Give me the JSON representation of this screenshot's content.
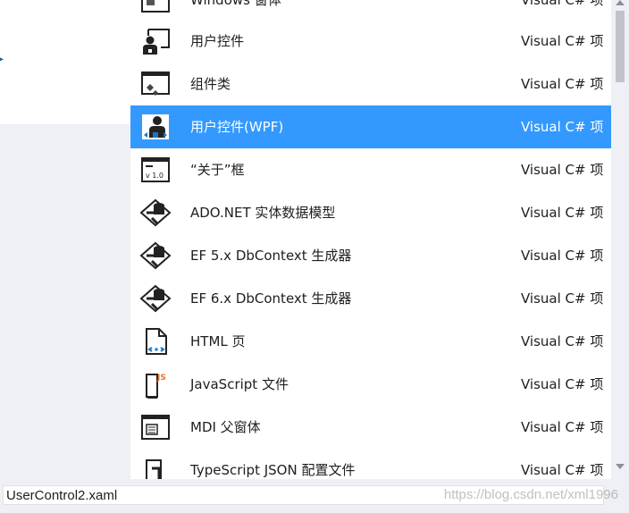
{
  "items": [
    {
      "name": "Windows 窗体",
      "lang": "Visual C# 项",
      "icon": "windows-form-icon",
      "selected": false
    },
    {
      "name": "用户控件",
      "lang": "Visual C# 项",
      "icon": "user-control-icon",
      "selected": false
    },
    {
      "name": "组件类",
      "lang": "Visual C# 项",
      "icon": "component-class-icon",
      "selected": false
    },
    {
      "name": "用户控件(WPF)",
      "lang": "Visual C# 项",
      "icon": "user-control-wpf-icon",
      "selected": true
    },
    {
      "name": "“关于”框",
      "lang": "Visual C# 项",
      "icon": "about-box-icon",
      "selected": false
    },
    {
      "name": "ADO.NET 实体数据模型",
      "lang": "Visual C# 项",
      "icon": "entity-data-model-icon",
      "selected": false
    },
    {
      "name": "EF 5.x DbContext 生成器",
      "lang": "Visual C# 项",
      "icon": "dbcontext-generator-icon",
      "selected": false
    },
    {
      "name": "EF 6.x DbContext 生成器",
      "lang": "Visual C# 项",
      "icon": "dbcontext-generator-icon",
      "selected": false
    },
    {
      "name": "HTML 页",
      "lang": "Visual C# 项",
      "icon": "html-page-icon",
      "selected": false
    },
    {
      "name": "JavaScript 文件",
      "lang": "Visual C# 项",
      "icon": "javascript-file-icon",
      "selected": false
    },
    {
      "name": "MDI 父窗体",
      "lang": "Visual C# 项",
      "icon": "mdi-parent-form-icon",
      "selected": false
    },
    {
      "name": "TypeScript JSON 配置文件",
      "lang": "Visual C# 项",
      "icon": "typescript-json-config-icon",
      "selected": false
    }
  ],
  "name_field": {
    "value": "UserControl2.xaml"
  },
  "watermark": "https://blog.csdn.net/xml1996",
  "colors": {
    "selection": "#3399ff",
    "background": "#eef0f6",
    "accent_blue": "#1e5ea8"
  }
}
